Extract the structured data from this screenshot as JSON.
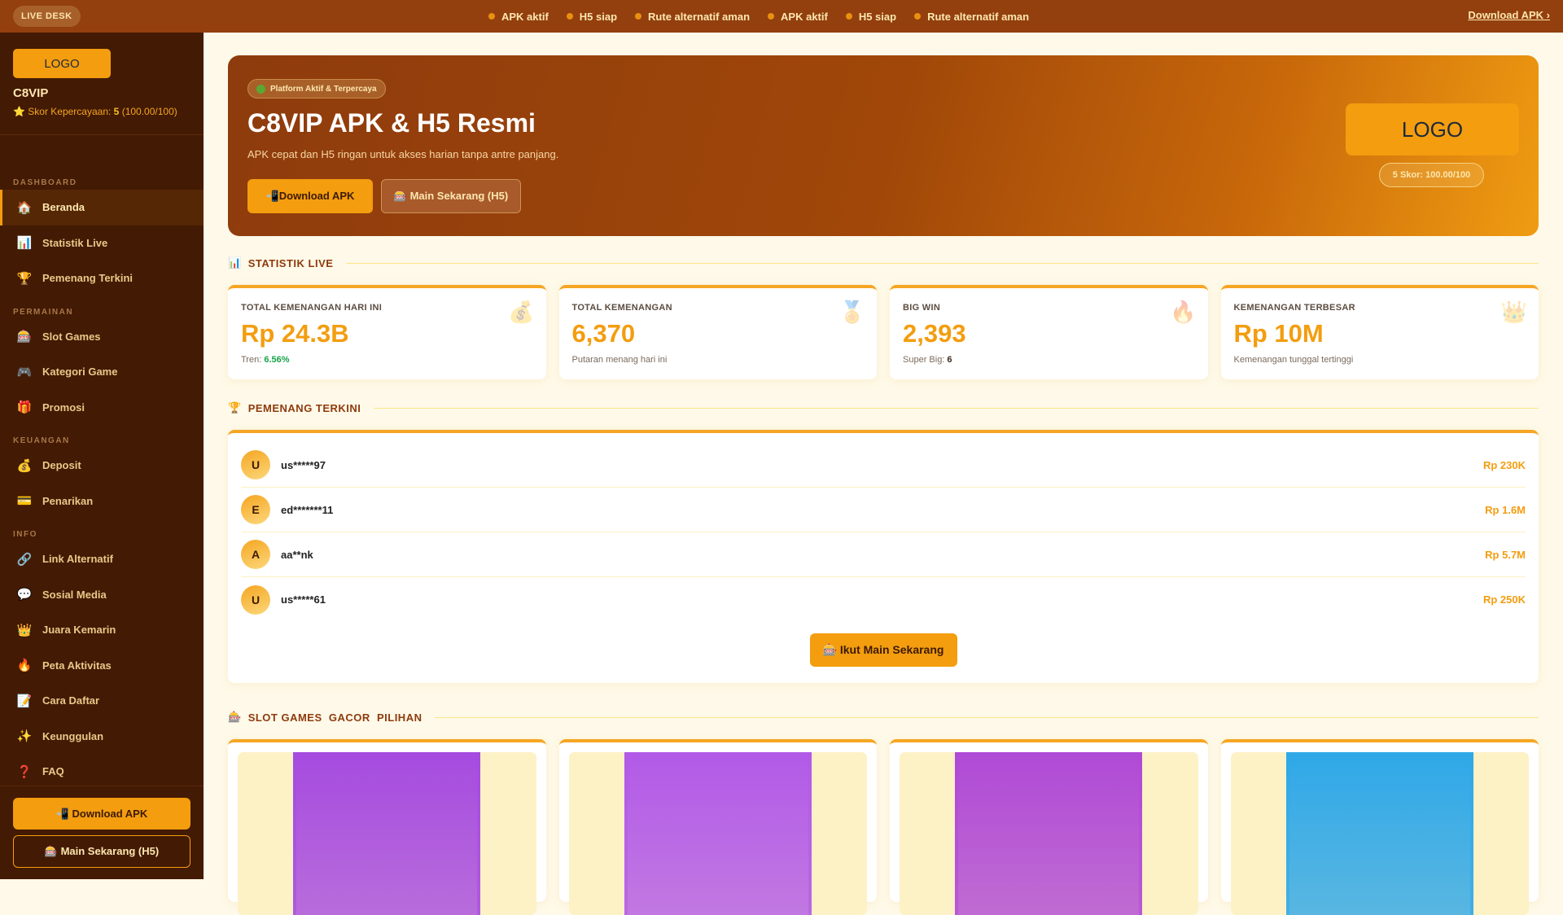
{
  "topbar": {
    "live_label": "LIVE DESK",
    "ticker": [
      "APK aktif",
      "H5 siap",
      "Rute alternatif aman",
      "APK aktif",
      "H5 siap",
      "Rute alternatif aman"
    ],
    "download_link": "Download APK ›"
  },
  "sidebar": {
    "logo": "LOGO",
    "brand": "C8VIP",
    "score_prefix": "⭐ Skor Kepercayaan: ",
    "score_value": "5",
    "score_detail": " (100.00/100)",
    "sections": [
      {
        "label": "DASHBOARD",
        "items": [
          {
            "icon": "🏠",
            "label": "Beranda",
            "active": true
          },
          {
            "icon": "📊",
            "label": "Statistik Live"
          },
          {
            "icon": "🏆",
            "label": "Pemenang Terkini"
          }
        ]
      },
      {
        "label": "PERMAINAN",
        "items": [
          {
            "icon": "🎰",
            "label": "Slot Games"
          },
          {
            "icon": "🎮",
            "label": "Kategori Game"
          },
          {
            "icon": "🎁",
            "label": "Promosi"
          }
        ]
      },
      {
        "label": "KEUANGAN",
        "items": [
          {
            "icon": "💰",
            "label": "Deposit"
          },
          {
            "icon": "💳",
            "label": "Penarikan"
          }
        ]
      },
      {
        "label": "INFO",
        "items": [
          {
            "icon": "🔗",
            "label": "Link Alternatif"
          },
          {
            "icon": "💬",
            "label": "Sosial Media"
          },
          {
            "icon": "👑",
            "label": "Juara Kemarin"
          },
          {
            "icon": "🔥",
            "label": "Peta Aktivitas"
          },
          {
            "icon": "📝",
            "label": "Cara Daftar"
          },
          {
            "icon": "✨",
            "label": "Keunggulan"
          },
          {
            "icon": "❓",
            "label": "FAQ"
          }
        ]
      }
    ],
    "download_btn": "📲 Download APK",
    "play_btn": "🎰 Main Sekarang (H5)"
  },
  "hero": {
    "badge": "Platform Aktif & Terpercaya",
    "title": "C8VIP APK & H5 Resmi",
    "subtitle": "APK cepat dan H5 ringan untuk akses harian tanpa antre panjang.",
    "download_btn": "📲Download APK",
    "play_btn": "🎰 Main Sekarang (H5)",
    "logo": "LOGO",
    "score": "5 Skor: 100.00/100"
  },
  "stats": {
    "title": "STATISTIK LIVE",
    "icon": "📊",
    "cards": [
      {
        "label": "TOTAL KEMENANGAN HARI INI",
        "value": "Rp 24.3B",
        "sub": "Tren: ",
        "sub_value": "6.56%",
        "icon": "💰"
      },
      {
        "label": "TOTAL KEMENANGAN",
        "value": "6,370",
        "sub": "Putaran menang hari ini",
        "sub_value": "",
        "icon": "🏅"
      },
      {
        "label": "BIG WIN",
        "value": "2,393",
        "sub": "Super Big: ",
        "sub_value": "6",
        "icon": "🔥"
      },
      {
        "label": "KEMENANGAN TERBESAR",
        "value": "Rp 10M",
        "sub": "Kemenangan tunggal tertinggi",
        "sub_value": "",
        "icon": "👑"
      }
    ]
  },
  "winners": {
    "title": "PEMENANG TERKINI",
    "icon": "🏆",
    "rows": [
      {
        "initial": "U",
        "name": "us*****97",
        "amount": "Rp 230K"
      },
      {
        "initial": "E",
        "name": "ed*******11",
        "amount": "Rp 1.6M"
      },
      {
        "initial": "A",
        "name": "aa**nk",
        "amount": "Rp 5.7M"
      },
      {
        "initial": "U",
        "name": "us*****61",
        "amount": "Rp 250K"
      }
    ],
    "cta": "🎰 Ikut Main Sekarang"
  },
  "slots": {
    "title": "SLOT GAMES  GACOR  PILIHAN",
    "icon": "🎰",
    "colors": [
      "#a64be0",
      "#b25ae8",
      "#b04ad6",
      "#2fa8e8"
    ]
  }
}
